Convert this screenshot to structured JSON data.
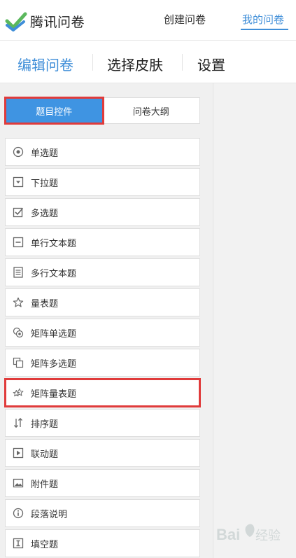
{
  "header": {
    "logo_text": "腾讯问卷",
    "nav": [
      {
        "label": "创建问卷"
      },
      {
        "label": "我的问卷"
      }
    ]
  },
  "tabs": [
    {
      "label": "编辑问卷"
    },
    {
      "label": "选择皮肤"
    },
    {
      "label": "设置"
    }
  ],
  "segmented": {
    "controls": "题目控件",
    "outline": "问卷大纲"
  },
  "question_types": [
    {
      "label": "单选题",
      "icon": "radio-icon"
    },
    {
      "label": "下拉题",
      "icon": "dropdown-icon"
    },
    {
      "label": "多选题",
      "icon": "checkbox-icon"
    },
    {
      "label": "单行文本题",
      "icon": "single-line-text-icon"
    },
    {
      "label": "多行文本题",
      "icon": "multi-line-text-icon"
    },
    {
      "label": "量表题",
      "icon": "star-icon"
    },
    {
      "label": "矩阵单选题",
      "icon": "matrix-radio-icon"
    },
    {
      "label": "矩阵多选题",
      "icon": "matrix-checkbox-icon"
    },
    {
      "label": "矩阵量表题",
      "icon": "matrix-star-icon"
    },
    {
      "label": "排序题",
      "icon": "sort-icon"
    },
    {
      "label": "联动题",
      "icon": "play-icon"
    },
    {
      "label": "附件题",
      "icon": "image-icon"
    },
    {
      "label": "段落说明",
      "icon": "info-icon"
    },
    {
      "label": "填空题",
      "icon": "fill-blank-icon"
    }
  ],
  "colors": {
    "accent": "#3f8ed8",
    "highlight": "#e03b3b"
  }
}
